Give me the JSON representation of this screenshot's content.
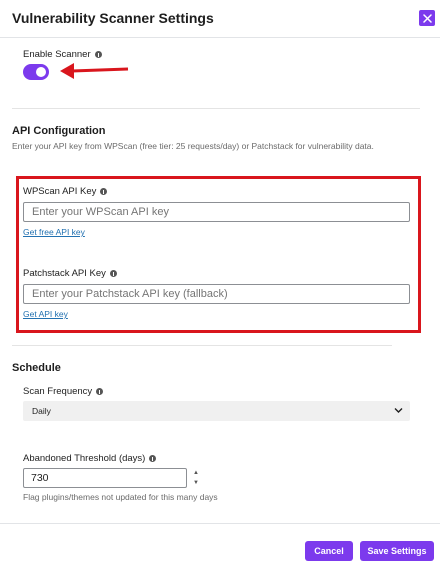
{
  "modal": {
    "title": "Vulnerability Scanner Settings"
  },
  "scanner": {
    "enable_label": "Enable Scanner",
    "enabled": true
  },
  "api": {
    "title": "API Configuration",
    "description": "Enter your API key from WPScan (free tier: 25 requests/day) or Patchstack for vulnerability data.",
    "wpscan": {
      "label": "WPScan API Key",
      "placeholder": "Enter your WPScan API key",
      "value": "",
      "link": "Get free API key"
    },
    "patchstack": {
      "label": "Patchstack API Key",
      "placeholder": "Enter your Patchstack API key (fallback)",
      "value": "",
      "link": "Get API key"
    }
  },
  "schedule": {
    "title": "Schedule",
    "frequency_label": "Scan Frequency",
    "frequency_value": "Daily",
    "threshold_label": "Abandoned Threshold (days)",
    "threshold_value": "730",
    "threshold_help": "Flag plugins/themes not updated for this many days"
  },
  "footer": {
    "cancel_label": "Cancel",
    "save_label": "Save Settings"
  },
  "colors": {
    "accent": "#7c3aed",
    "annotation": "#d9161d",
    "link": "#2271b1"
  },
  "icons": {
    "close": "close-icon",
    "info": "info-icon",
    "chevron": "chevron-down-icon",
    "arrow": "arrow-annotation"
  }
}
